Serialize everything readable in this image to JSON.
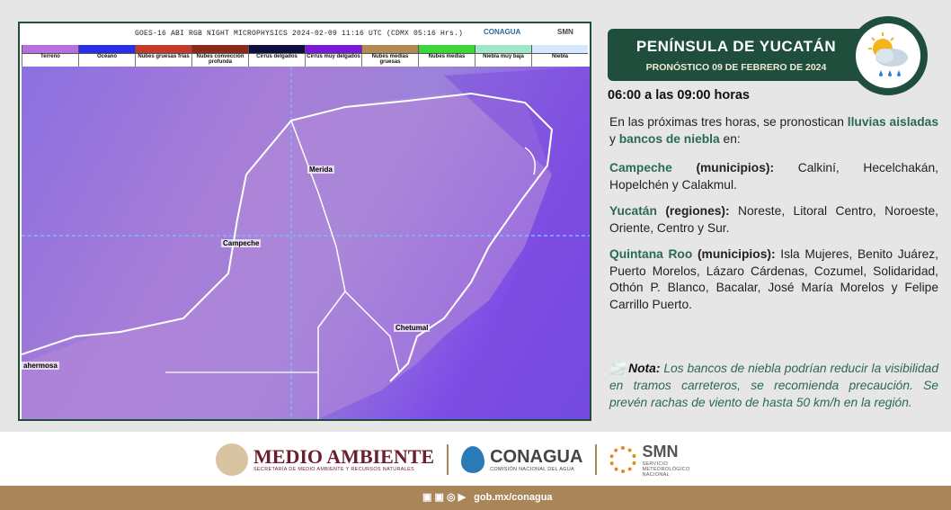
{
  "satellite": {
    "title": "GOES-16 ABI RGB NIGHT MICROPHYSICS 2024-02-09 11:16 UTC (CDMX  05:16 Hrs.)",
    "mini_logos": [
      "CONAGUA",
      "SMN"
    ],
    "legend": [
      {
        "label": "Terreno",
        "color": "#b76fe0"
      },
      {
        "label": "Océano",
        "color": "#2a2ee8"
      },
      {
        "label": "Nubes gruesas frías",
        "color": "#c43a2a"
      },
      {
        "label": "Nubes convección profunda",
        "color": "#8a2a1a"
      },
      {
        "label": "Cirrus delgados",
        "color": "#101040"
      },
      {
        "label": "Cirrus muy delgados",
        "color": "#7a1ad6"
      },
      {
        "label": "Nubes medias gruesas",
        "color": "#b58a52"
      },
      {
        "label": "Nubes medias",
        "color": "#3ad63a"
      },
      {
        "label": "Niebla muy baja",
        "color": "#a0e6c8"
      },
      {
        "label": "Niebla",
        "color": "#d6e8ff"
      }
    ],
    "cities": {
      "merida": "Merida",
      "campeche": "Campeche",
      "chetumal": "Chetumal",
      "other": "ahermosa"
    }
  },
  "banner": {
    "title": "PENÍNSULA DE YUCATÁN",
    "subtitle": "PRONÓSTICO 09 DE FEBRERO DE 2024",
    "icon": "sun-cloud-rain-icon"
  },
  "time_range": "06:00 a las 09:00 horas",
  "intro": {
    "pre": "En las próximas tres horas, se pronostican ",
    "hl1": "lluvias aisladas",
    "mid": " y  ",
    "hl2": "bancos de niebla",
    "post": " en:"
  },
  "regions": [
    {
      "name": "Campeche",
      "kind": " (municipios):",
      "places": " Calkiní, Hecelchakán, Hopelchén y Calakmul."
    },
    {
      "name": "Yucatán",
      "kind": " (regiones):",
      "places": " Noreste, Litoral Centro, Noroeste, Oriente, Centro y Sur."
    },
    {
      "name": "Quintana Roo",
      "kind": " (municipios):",
      "places": " Isla Mujeres, Benito Juárez, Puerto Morelos, Lázaro Cárdenas, Cozumel, Solidaridad, Othón P. Blanco, Bacalar, José María Morelos y Felipe Carrillo Puerto."
    }
  ],
  "note": {
    "label": "Nota:",
    "text": " Los bancos de niebla podrían reducir la visibilidad en tramos carreteros, se recomienda precaución. Se prevén rachas de viento de hasta 50 km/h en la región."
  },
  "footer": {
    "logo1": "MEDIO AMBIENTE",
    "logo1_sub": "SECRETARÍA DE MEDIO AMBIENTE Y RECURSOS NATURALES",
    "logo2": "CONAGUA",
    "logo2_sub": "COMISIÓN NACIONAL DEL AGUA",
    "logo3": "SMN",
    "logo3_sub": "SERVICIO METEOROLÓGICO NACIONAL",
    "social_text": "gob.mx/conagua"
  },
  "colors": {
    "brand_green": "#1f4e3d",
    "accent_green": "#2a6a50",
    "gold": "#a8865a",
    "wine": "#6b1e2e"
  }
}
